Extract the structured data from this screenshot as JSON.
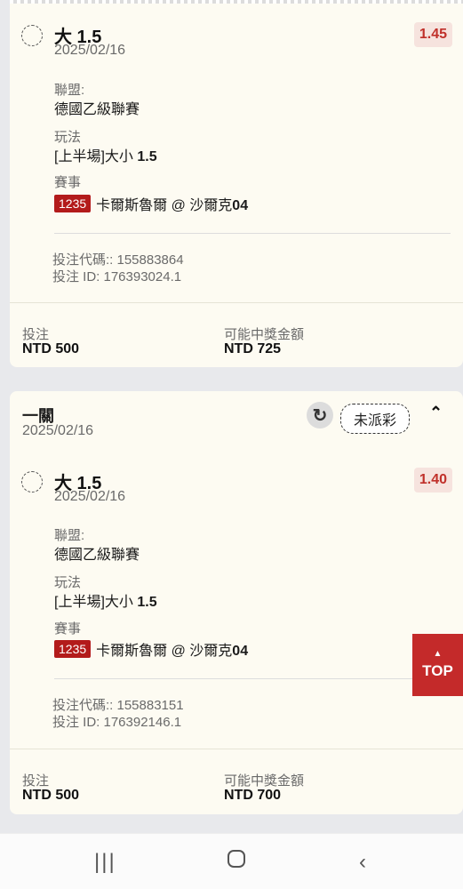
{
  "bets": [
    {
      "selection": "大 1.5",
      "date": "2025/02/16",
      "odds": "1.45",
      "league_label": "聯盟:",
      "league": "德國乙級聯賽",
      "market_label": "玩法",
      "market_prefix": "[上半場]大小",
      "market_line": "1.5",
      "event_label": "賽事",
      "event_code": "1235",
      "event_teams": "卡爾斯魯爾 @ 沙爾克",
      "event_suffix": "04",
      "bet_code": "投注代碼:: 155883864",
      "bet_id": "投注 ID: 176393024.1",
      "stake_label": "投注",
      "stake": "NTD 500",
      "payout_label": "可能中獎金額",
      "payout": "NTD 725"
    }
  ],
  "ticket": {
    "title": "一關",
    "date": "2025/02/16",
    "status": "未派彩",
    "bet": {
      "selection": "大 1.5",
      "date": "2025/02/16",
      "odds": "1.40",
      "league_label": "聯盟:",
      "league": "德國乙級聯賽",
      "market_label": "玩法",
      "market_prefix": "[上半場]大小",
      "market_line": "1.5",
      "event_label": "賽事",
      "event_code": "1235",
      "event_teams": "卡爾斯魯爾 @ 沙爾克",
      "event_suffix": "04",
      "bet_code": "投注代碼:: 155883151",
      "bet_id": "投注 ID: 176392146.1",
      "stake_label": "投注",
      "stake": "NTD 500",
      "payout_label": "可能中獎金額",
      "payout": "NTD 700"
    }
  },
  "top_button": "TOP",
  "icons": {
    "refresh": "refresh-icon",
    "collapse": "chevron-up-icon",
    "back_to_top": "arrow-up-icon",
    "recents": "recents-icon",
    "home": "home-icon",
    "back": "back-icon"
  },
  "colors": {
    "accent": "#b31b1b",
    "odds_bg": "#f6e3de",
    "card_bg": "#fdfbf2"
  }
}
